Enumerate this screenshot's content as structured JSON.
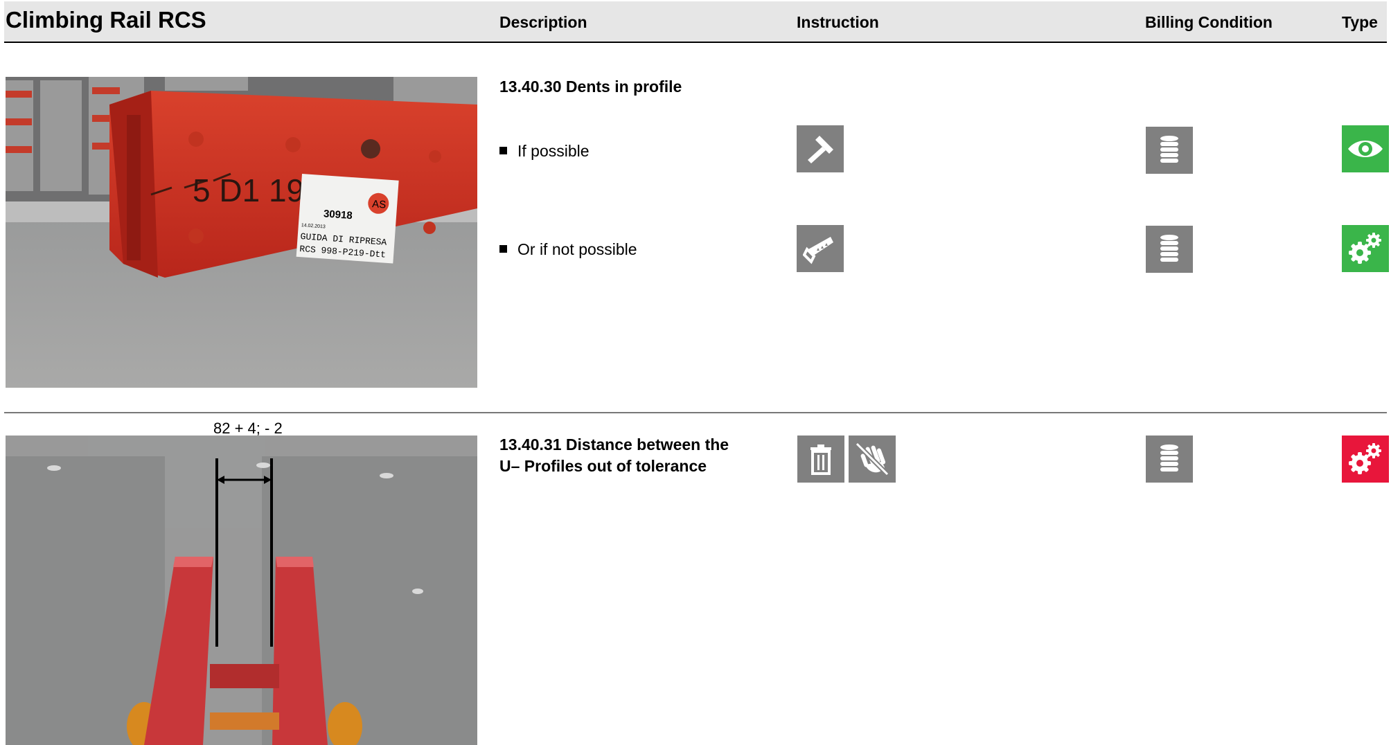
{
  "header": {
    "title": "Climbing Rail RCS",
    "columns": {
      "description": "Description",
      "instruction": "Instruction",
      "billing": "Billing Condition",
      "type": "Type"
    }
  },
  "rows": [
    {
      "heading": "13.40.30 Dents in profile",
      "photo_label": {
        "marking": "5 D1 19",
        "tag_number": "30918",
        "tag_badge": "AS",
        "tag_date": "14.02.2013",
        "tag_line1": "GUIDA DI RIPRESA",
        "tag_line2": "RCS 998-P219-Dtt"
      },
      "items": [
        {
          "text": "If possible",
          "instruction_icon": "hammer-icon",
          "billing_icon": "coin-stack-icon",
          "type_icon": "eye-icon",
          "type_color": "#3ab54a"
        },
        {
          "text": "Or if not possible",
          "instruction_icon": "saw-icon",
          "billing_icon": "coin-stack-icon",
          "type_icon": "gears-icon",
          "type_color": "#3ab54a"
        }
      ]
    },
    {
      "heading_line1": "13.40.31 Distance between the",
      "heading_line2": "U– Profiles out of tolerance",
      "dimension_label": "82 + 4; - 2",
      "instruction_icons": [
        "trash-icon",
        "no-touch-icon"
      ],
      "billing_icon": "coin-stack-icon",
      "type_icon": "gears-icon",
      "type_color": "#e8163b"
    }
  ],
  "colors": {
    "grey_icon": "#808080",
    "green": "#3ab54a",
    "red": "#e8163b",
    "header_bg": "#e6e6e6"
  }
}
